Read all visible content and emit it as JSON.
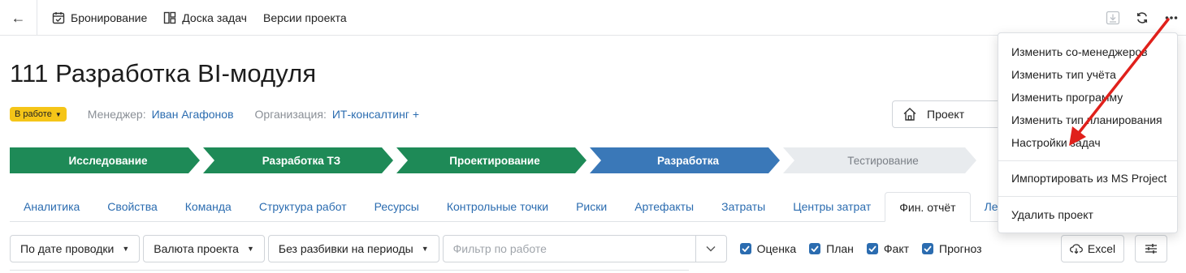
{
  "topbar": {
    "nav": [
      {
        "label": "Бронирование",
        "icon": "calendar-check-icon"
      },
      {
        "label": "Доска задач",
        "icon": "board-icon"
      },
      {
        "label": "Версии проекта",
        "icon": ""
      }
    ],
    "icons": [
      "download-icon",
      "refresh-icon",
      "more-icon"
    ]
  },
  "project": {
    "title": "111 Разработка BI-модуля",
    "status": "В работе",
    "manager_label": "Менеджер:",
    "manager": "Иван Агафонов",
    "org_label": "Организация:",
    "org": "ИТ-консалтинг +",
    "type_button": "Проект"
  },
  "stages": [
    {
      "label": "Исследование",
      "state": "done",
      "color": "#1e8a57"
    },
    {
      "label": "Разработка ТЗ",
      "state": "done",
      "color": "#1e8a57"
    },
    {
      "label": "Проектирование",
      "state": "done",
      "color": "#1e8a57"
    },
    {
      "label": "Разработка",
      "state": "current",
      "color": "#3a78b8"
    },
    {
      "label": "Тестирование",
      "state": "pending",
      "color": "#e8ebee"
    }
  ],
  "tabs": [
    {
      "label": "Аналитика"
    },
    {
      "label": "Свойства"
    },
    {
      "label": "Команда"
    },
    {
      "label": "Структура работ"
    },
    {
      "label": "Ресурсы"
    },
    {
      "label": "Контрольные точки"
    },
    {
      "label": "Риски"
    },
    {
      "label": "Артефакты"
    },
    {
      "label": "Затраты"
    },
    {
      "label": "Центры затрат"
    },
    {
      "label": "Фин. отчёт",
      "active": true
    },
    {
      "label": "Лента"
    }
  ],
  "filters": {
    "by_date": "По дате проводки",
    "currency": "Валюта проекта",
    "periods": "Без разбивки на периоды",
    "work_filter_placeholder": "Фильтр по работе",
    "checkboxes": [
      {
        "label": "Оценка",
        "checked": true
      },
      {
        "label": "План",
        "checked": true
      },
      {
        "label": "Факт",
        "checked": true
      },
      {
        "label": "Прогноз",
        "checked": true
      }
    ],
    "excel": "Excel"
  },
  "menu": {
    "group1": [
      "Изменить со-менеджеров",
      "Изменить тип учёта",
      "Изменить программу",
      "Изменить тип планирования",
      "Настройки задач"
    ],
    "group2": [
      "Импортировать из MS Project"
    ],
    "group3": [
      "Удалить проект"
    ]
  },
  "colors": {
    "accent": "#2b6cb0",
    "status_badge": "#f5c518",
    "annotation_arrow": "#e0201b"
  }
}
